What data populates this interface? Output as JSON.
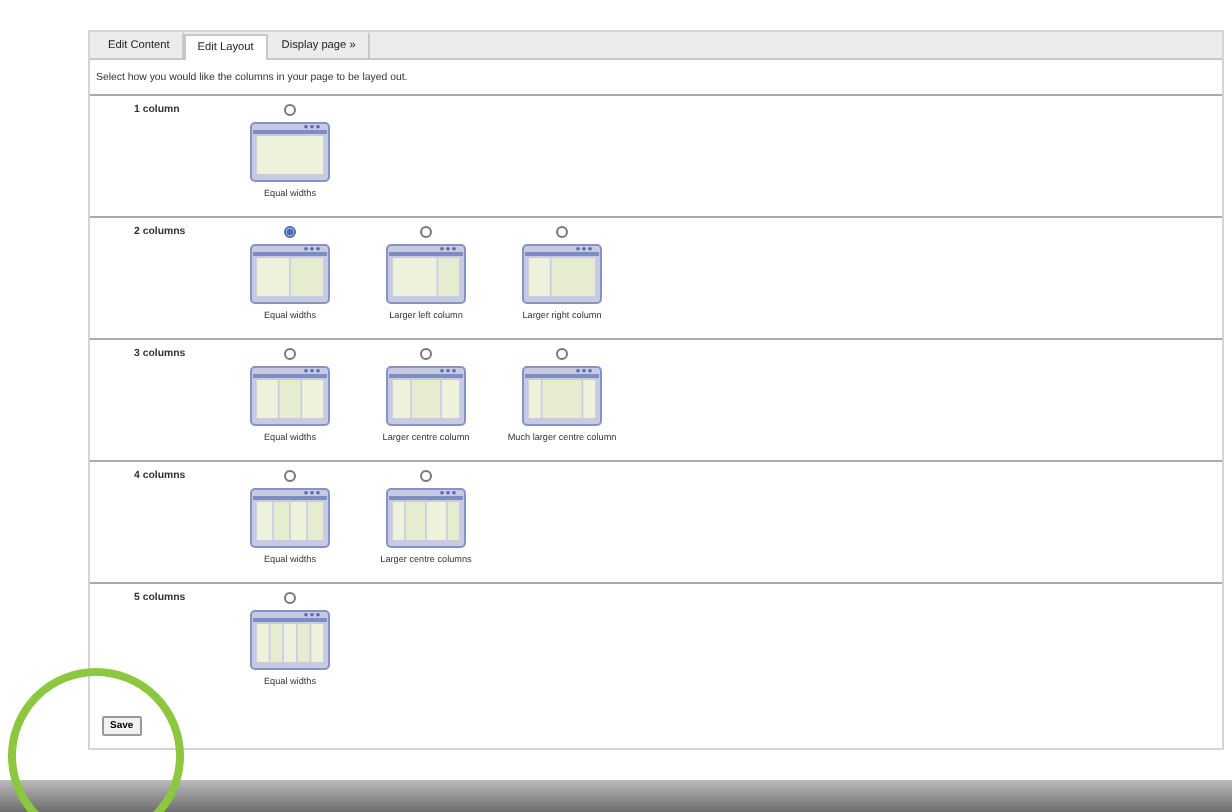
{
  "tabs": [
    {
      "label": "Edit Content",
      "selected": false
    },
    {
      "label": "Edit Layout",
      "selected": true
    },
    {
      "label": "Display page »",
      "selected": false
    }
  ],
  "instruction": "Select how you would like the columns in your page to be layed out.",
  "sections": [
    {
      "label": "1 column",
      "options": [
        {
          "kind": "equal",
          "caption": "Equal widths",
          "selected": false
        }
      ]
    },
    {
      "label": "2 columns",
      "options": [
        {
          "kind": "equal",
          "caption": "Equal widths",
          "selected": true
        },
        {
          "kind": "left",
          "caption": "Larger left column",
          "selected": false
        },
        {
          "kind": "right",
          "caption": "Larger right column",
          "selected": false
        }
      ]
    },
    {
      "label": "3 columns",
      "options": [
        {
          "kind": "equal",
          "caption": "Equal widths",
          "selected": false
        },
        {
          "kind": "centre",
          "caption": "Larger centre column",
          "selected": false
        },
        {
          "kind": "widecentre",
          "caption": "Much larger centre column",
          "selected": false
        }
      ]
    },
    {
      "label": "4 columns",
      "options": [
        {
          "kind": "equal",
          "caption": "Equal widths",
          "selected": false
        },
        {
          "kind": "centre",
          "caption": "Larger centre columns",
          "selected": false
        }
      ]
    },
    {
      "label": "5 columns",
      "options": [
        {
          "kind": "equal",
          "caption": "Equal widths",
          "selected": false
        }
      ]
    }
  ],
  "save": "Save"
}
